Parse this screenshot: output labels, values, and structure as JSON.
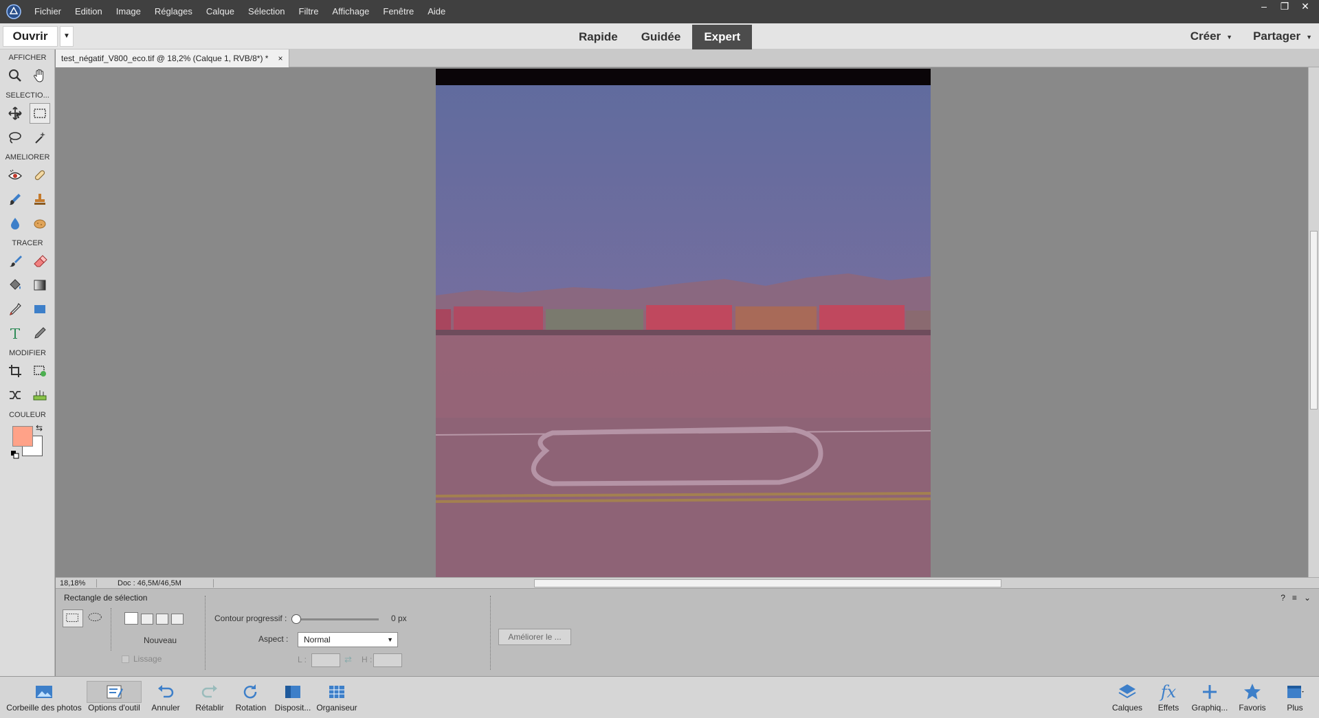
{
  "menubar": {
    "items": [
      "Fichier",
      "Edition",
      "Image",
      "Réglages",
      "Calque",
      "Sélection",
      "Filtre",
      "Affichage",
      "Fenêtre",
      "Aide"
    ],
    "window_controls": [
      "–",
      "❐",
      "✕"
    ]
  },
  "modebar": {
    "open_label": "Ouvrir",
    "tabs": [
      "Rapide",
      "Guidée",
      "Expert"
    ],
    "active_tab": "Expert",
    "create_label": "Créer",
    "share_label": "Partager"
  },
  "toolbox": {
    "sections": {
      "view": "AFFICHER",
      "select": "SELECTIO...",
      "enhance": "AMELIORER",
      "draw": "TRACER",
      "modify": "MODIFIER",
      "color": "COULEUR"
    },
    "foreground_color": "#ffa288",
    "background_color": "#ffffff"
  },
  "document": {
    "tab_title": "test_négatif_V800_eco.tif @ 18,2% (Calque 1, RVB/8*) *",
    "close_glyph": "×"
  },
  "status": {
    "zoom": "18,18%",
    "doc_size": "Doc : 46,5M/46,5M"
  },
  "tool_options": {
    "title": "Rectangle de sélection",
    "mode_label": "Nouveau",
    "feather_label": "Contour progressif :",
    "feather_value": "0 px",
    "feather_level": 0,
    "aspect_label": "Aspect :",
    "aspect_value": "Normal",
    "width_label": "L :",
    "height_label": "H :",
    "refine_label": "Améliorer le ...",
    "smoothing_label": "Lissage"
  },
  "taskbar": {
    "left": [
      "Corbeille des photos",
      "Options d'outil",
      "Annuler",
      "Rétablir",
      "Rotation",
      "Disposit...",
      "Organiseur"
    ],
    "right": [
      "Calques",
      "Effets",
      "Graphiq...",
      "Favoris",
      "Plus"
    ]
  },
  "icons": {
    "taskbar_accent": "#3d7fc9"
  }
}
